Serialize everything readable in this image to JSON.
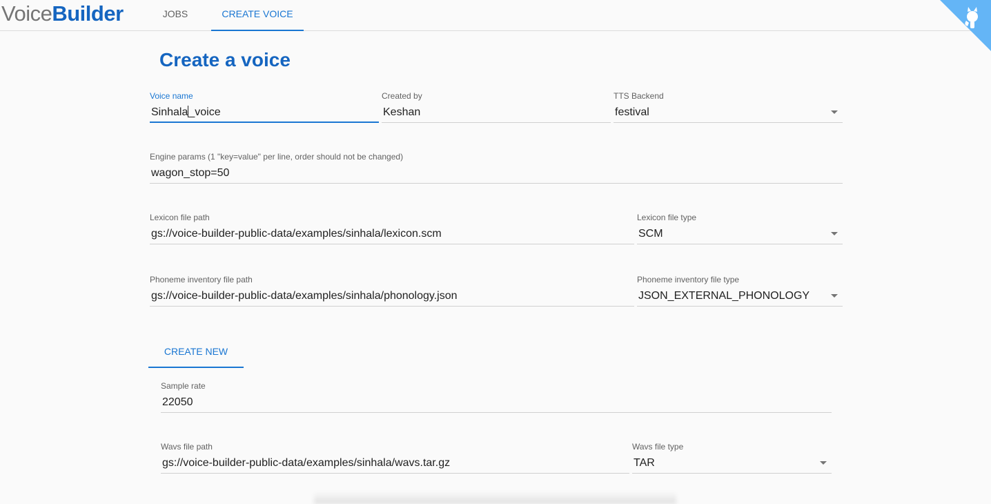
{
  "app": {
    "logo_part1": "Voice",
    "logo_part2": "Builder",
    "nav": [
      {
        "label": "JOBS"
      },
      {
        "label": "CREATE VOICE"
      }
    ]
  },
  "page": {
    "title": "Create a voice"
  },
  "form": {
    "voice_name": {
      "label": "Voice name",
      "value_before_caret": "Sinhala",
      "value_after_caret": "_voice"
    },
    "created_by": {
      "label": "Created by",
      "value": "Keshan"
    },
    "tts_backend": {
      "label": "TTS Backend",
      "value": "festival"
    },
    "engine_params": {
      "label": "Engine params (1 \"key=value\" per line, order should not be changed)",
      "value": "wagon_stop=50"
    },
    "lexicon_path": {
      "label": "Lexicon file path",
      "value": "gs://voice-builder-public-data/examples/sinhala/lexicon.scm"
    },
    "lexicon_type": {
      "label": "Lexicon file type",
      "value": "SCM"
    },
    "phoneme_path": {
      "label": "Phoneme inventory file path",
      "value": "gs://voice-builder-public-data/examples/sinhala/phonology.json"
    },
    "phoneme_type": {
      "label": "Phoneme inventory file type",
      "value": "JSON_EXTERNAL_PHONOLOGY"
    }
  },
  "data_section": {
    "tab_label": "CREATE NEW",
    "sample_rate": {
      "label": "Sample rate",
      "value": "22050"
    },
    "wavs_path": {
      "label": "Wavs file path",
      "value": "gs://voice-builder-public-data/examples/sinhala/wavs.tar.gz"
    },
    "wavs_type": {
      "label": "Wavs file type",
      "value": "TAR"
    }
  },
  "colors": {
    "accent": "#1976d2",
    "title": "#1565c0",
    "corner_ribbon": "#64b5f6"
  },
  "icons": {
    "corner": "github-octocat-icon"
  }
}
